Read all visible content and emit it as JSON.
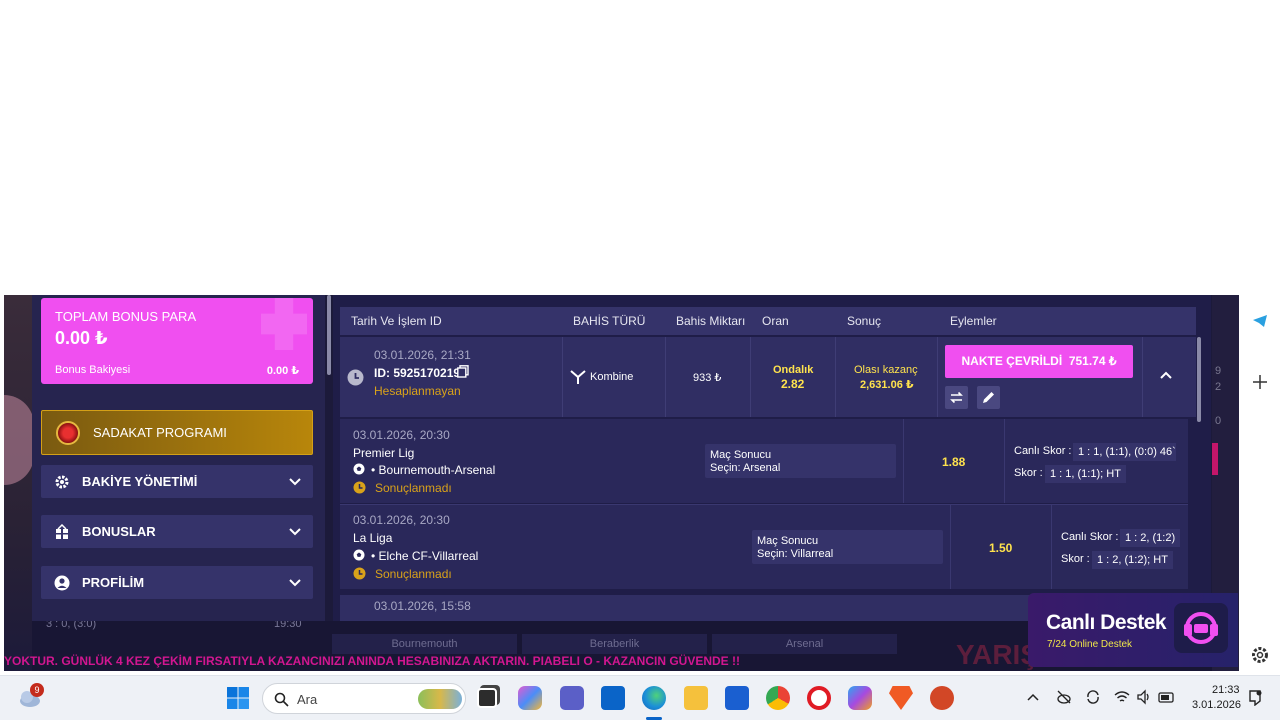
{
  "sidebar": {
    "bonus": {
      "title": "TOPLAM BONUS PARA",
      "amount": "0.00 ₺",
      "sub_label": "Bonus Bakiyesi",
      "sub_value": "0.00 ₺"
    },
    "loyalty": "SADAKAT PROGRAMI",
    "menu": [
      {
        "label": "BAKİYE YÖNETİMİ",
        "icon": "gear-icon"
      },
      {
        "label": "BONUSLAR",
        "icon": "gift-icon"
      },
      {
        "label": "PROFİLİM",
        "icon": "user-icon"
      }
    ]
  },
  "table": {
    "headers": [
      "Tarih Ve İşlem ID",
      "BAHİS TÜRÜ",
      "Bahis Miktarı",
      "Oran",
      "Sonuç",
      "Eylemler"
    ]
  },
  "bet": {
    "datetime": "03.01.2026, 21:31",
    "id": "ID: 5925170219",
    "status": "Hesaplanmayan",
    "type": "Kombine",
    "amount": "933 ₺",
    "odds_label": "Ondalık",
    "odds_value": "2.82",
    "result_label": "Olası kazanç",
    "result_value": "2,631.06 ₺",
    "cashout_label": "NAKTE ÇEVRİLDİ",
    "cashout_value": "751.74 ₺"
  },
  "selections": [
    {
      "datetime": "03.01.2026, 20:30",
      "league": "Premier Lig",
      "match": "• Bournemouth-Arsenal",
      "status": "Sonuçlanmadı",
      "market": "Maç Sonucu",
      "pick": "Seçin: Arsenal",
      "odds": "1.88",
      "live_label": "Canlı Skor :",
      "live_value": "1 : 1, (1:1), (0:0) 46`",
      "score_label": "Skor :",
      "score_value": "1 : 1, (1:1); HT"
    },
    {
      "datetime": "03.01.2026, 20:30",
      "league": "La Liga",
      "match": "• Elche CF-Villarreal",
      "status": "Sonuçlanmadı",
      "market": "Maç Sonucu",
      "pick": "Seçin: Villarreal",
      "odds": "1.50",
      "live_label": "Canlı Skor :",
      "live_value": "1 : 2, (1:2)",
      "score_label": "Skor :",
      "score_value": "1 : 2, (1:2); HT"
    }
  ],
  "partial_row": {
    "datetime": "03.01.2026, 15:58"
  },
  "background": {
    "score_left": "3 : 0, (3:0)",
    "time_left": "19:30",
    "cells": [
      "Bournemouth",
      "Beraberlik",
      "Arsenal"
    ],
    "ticker": "YOKTUR. GÜNLÜK 4 KEZ ÇEKİM FIRSATIYLA KAZANCINIZI ANINDA HESABINIZA AKTARIN. PIABELI         O - KAZANCIN GÜVENDE !!",
    "side_numbers": [
      "9",
      "2",
      "0"
    ],
    "yaris": "YARIŞ"
  },
  "support": {
    "title": "Canlı Destek",
    "subtitle": "7/24 Online Destek"
  },
  "taskbar": {
    "weather_badge": "9",
    "search_placeholder": "Ara",
    "time": "21:33",
    "date": "3.01.2026"
  },
  "colors": {
    "accent_pink": "#f04ff0",
    "panel": "#26244f",
    "highlight_yellow": "#ffe34d",
    "status_orange": "#d9a21a"
  }
}
